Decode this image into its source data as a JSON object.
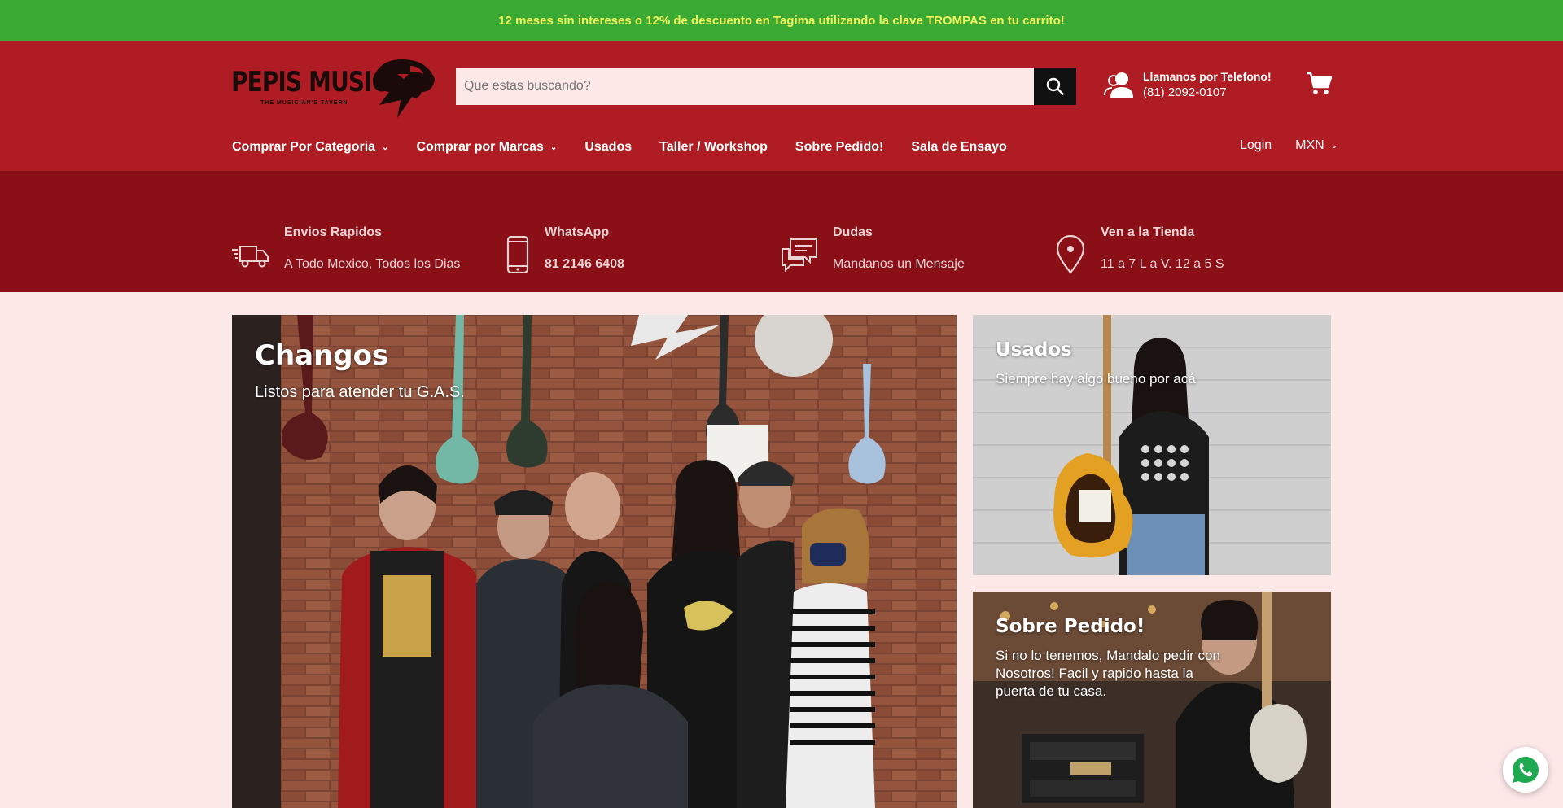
{
  "promo": {
    "text": "12 meses sin intereses o 12% de descuento en Tagima utilizando la clave TROMPAS en tu carrito!"
  },
  "header": {
    "logo": {
      "name": "PEPIS MUSIC",
      "tagline": "THE MUSICIAN'S TAVERN"
    },
    "search": {
      "placeholder": "Que estas buscando?",
      "value": ""
    },
    "phone": {
      "title": "Llamanos por Telefono!",
      "number": "(81) 2092-0107"
    },
    "colors": {
      "promo_bg": "#3aaa35",
      "promo_text": "#f2f25a",
      "header_bg": "#b01c24",
      "features_bg": "#8b0f17",
      "page_bg": "#fde8e8"
    }
  },
  "nav": {
    "items": [
      {
        "label": "Comprar Por Categoria",
        "dropdown": true
      },
      {
        "label": "Comprar por Marcas",
        "dropdown": true
      },
      {
        "label": "Usados",
        "dropdown": false
      },
      {
        "label": "Taller / Workshop",
        "dropdown": false
      },
      {
        "label": "Sobre Pedido!",
        "dropdown": false
      },
      {
        "label": "Sala de Ensayo",
        "dropdown": false
      }
    ],
    "login": "Login",
    "currency": "MXN"
  },
  "features": [
    {
      "icon": "delivery-truck-icon",
      "title": "Envios Rapidos",
      "subtitle": "A Todo Mexico, Todos los Dias"
    },
    {
      "icon": "phone-icon",
      "title": "WhatsApp",
      "subtitle": "81 2146 6408"
    },
    {
      "icon": "chat-icon",
      "title": "Dudas",
      "subtitle": "Mandanos un Mensaje"
    },
    {
      "icon": "location-pin-icon",
      "title": "Ven a la Tienda",
      "subtitle": "11 a 7 L a V. 12 a 5 S"
    }
  ],
  "heroes": {
    "main": {
      "title": "Changos",
      "subtitle": "Listos para atender tu G.A.S."
    },
    "side1": {
      "title": "Usados",
      "subtitle": "Siempre hay algo bueno por acá"
    },
    "side2": {
      "title": "Sobre Pedido!",
      "subtitle": "Si no lo tenemos, Mandalo pedir con Nosotros! Facil y rapido hasta la puerta de tu casa."
    }
  }
}
